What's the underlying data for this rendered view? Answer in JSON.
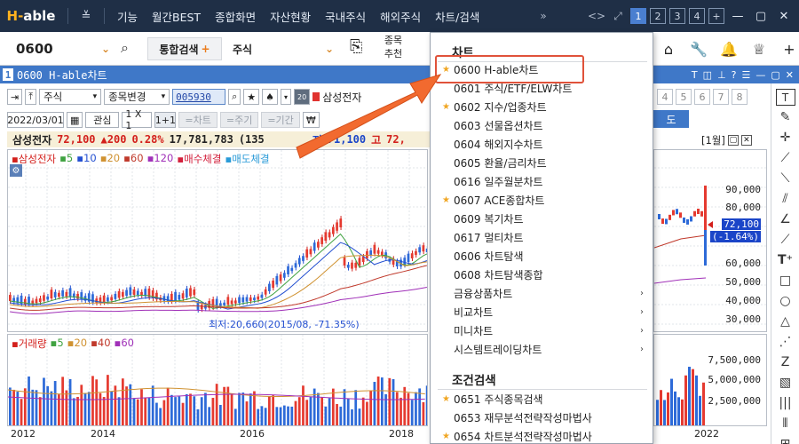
{
  "topbar": {
    "logo": "able",
    "logo_prefix": "H-",
    "menus": [
      "기능",
      "월간BEST",
      "종합화면",
      "자산현황",
      "국내주식",
      "해외주식",
      "차트/검색"
    ],
    "more": "»",
    "pages": [
      "1",
      "2",
      "3",
      "4",
      "+"
    ]
  },
  "searchbar": {
    "code": "0600",
    "integrated_search": "통합검색",
    "integrated_plus": "+",
    "stock_type": "주식",
    "recommend_line1": "종목",
    "recommend_line2": "추천"
  },
  "window": {
    "number": "1",
    "title": "0600 H-able차트"
  },
  "toolbar": {
    "market": "주식",
    "change_stock": "종목변경",
    "code_field": "005930",
    "stock_name": "삼성전자",
    "date": "2022/03/01",
    "interest": "관심",
    "grid": "1 X 1",
    "grid2": "1+1",
    "buttons": [
      "=차트",
      "=주기",
      "=기간"
    ]
  },
  "quote": {
    "name": "삼성전자",
    "price": "72,100",
    "change": "▲200",
    "pct": "0.28%",
    "volume": "17,781,783",
    "volume_tail": "(135",
    "open_tail": "저",
    "low": "71,100",
    "high_label": "고",
    "high": "72,"
  },
  "price_legend": {
    "name": "삼성전자",
    "mas": [
      "5",
      "10",
      "20",
      "60",
      "120"
    ],
    "buy": "매수체결",
    "sell": "매도체결"
  },
  "volume_legend": {
    "name": "거래량",
    "mas": [
      "5",
      "20",
      "40",
      "60"
    ]
  },
  "annotation": "최저:20,660(2015/08, -71.35%)",
  "x_labels": [
    "2012",
    "2014",
    "2016",
    "2018"
  ],
  "right_panel": {
    "pages": [
      "4",
      "5",
      "6",
      "7",
      "8"
    ],
    "tab": "도",
    "period": "[1월]",
    "price_labels": [
      "90,000",
      "80,000",
      "72,100",
      "(-1.64%)",
      "60,000",
      "50,000",
      "40,000",
      "30,000"
    ],
    "vol_labels": [
      "7,500,000",
      "5,000,000",
      "2,500,000"
    ],
    "x_label": "2022"
  },
  "dropdown": {
    "section1": "차트",
    "items1": [
      {
        "label": "0600 H-able차트",
        "star": true,
        "sub": false
      },
      {
        "label": "0601 주식/ETF/ELW차트",
        "star": false,
        "sub": false
      },
      {
        "label": "0602 지수/업종차트",
        "star": true,
        "sub": false
      },
      {
        "label": "0603 선물옵션차트",
        "star": false,
        "sub": false
      },
      {
        "label": "0604 해외지수차트",
        "star": false,
        "sub": false
      },
      {
        "label": "0605 환율/금리차트",
        "star": false,
        "sub": false
      },
      {
        "label": "0616 일주월분차트",
        "star": false,
        "sub": false
      },
      {
        "label": "0607 ACE종합차트",
        "star": true,
        "sub": false
      },
      {
        "label": "0609 복기차트",
        "star": false,
        "sub": false
      },
      {
        "label": "0617 멀티차트",
        "star": false,
        "sub": false
      },
      {
        "label": "0606 차트탐색",
        "star": false,
        "sub": false
      },
      {
        "label": "0608 차트탐색종합",
        "star": false,
        "sub": false
      },
      {
        "label": "금융상품차트",
        "star": false,
        "sub": true
      },
      {
        "label": "비교차트",
        "star": false,
        "sub": true
      },
      {
        "label": "미니차트",
        "star": false,
        "sub": true
      },
      {
        "label": "시스템트레이딩차트",
        "star": false,
        "sub": true
      }
    ],
    "section2": "조건검색",
    "items2": [
      {
        "label": "0651 주식종목검색",
        "star": true,
        "sub": false
      },
      {
        "label": "0653 재무분석전략작성마법사",
        "star": false,
        "sub": false
      },
      {
        "label": "0654 차트분석전략작성마법사",
        "star": true,
        "sub": false
      }
    ]
  },
  "colors": {
    "topbar": "#1f2f46",
    "title_blue": "#3f78c8",
    "up_red": "#d3201c",
    "down_blue": "#1b45c8",
    "highlight": "#e0523a",
    "star": "#f0a623"
  }
}
